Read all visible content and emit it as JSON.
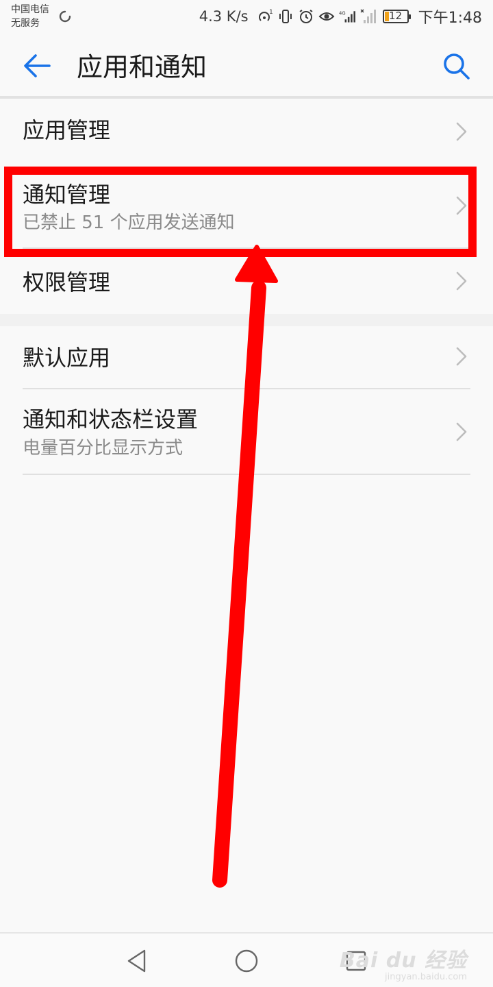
{
  "status_bar": {
    "carrier_line1": "中国电信",
    "carrier_line2": "无服务",
    "net_speed": "4.3 K/s",
    "battery_level": "12",
    "time": "下午1:48",
    "icons": [
      "sync-icon",
      "hotspot-icon",
      "vibrate-icon",
      "alarm-icon",
      "eye-comfort-icon",
      "signal-4g-icon",
      "signal-none-icon",
      "battery-icon"
    ]
  },
  "header": {
    "title": "应用和通知",
    "back_icon": "back-arrow-icon",
    "search_icon": "search-icon"
  },
  "list": {
    "items": [
      {
        "title": "应用管理",
        "subtitle": ""
      },
      {
        "title": "通知管理",
        "subtitle": "已禁止 51 个应用发送通知"
      },
      {
        "title": "权限管理",
        "subtitle": ""
      },
      {
        "title": "默认应用",
        "subtitle": ""
      },
      {
        "title": "通知和状态栏设置",
        "subtitle": "电量百分比显示方式"
      }
    ]
  },
  "annotation": {
    "color": "#ff0000"
  },
  "nav_bar": {
    "icons": [
      "back-triangle-icon",
      "home-circle-icon",
      "recents-square-icon"
    ]
  },
  "watermark": {
    "main": "Bai du 经验",
    "sub": "jingyan.baidu.com"
  },
  "colors": {
    "accent": "#1a73e8",
    "background": "#f9f9f9",
    "annotation": "#ff0000"
  }
}
